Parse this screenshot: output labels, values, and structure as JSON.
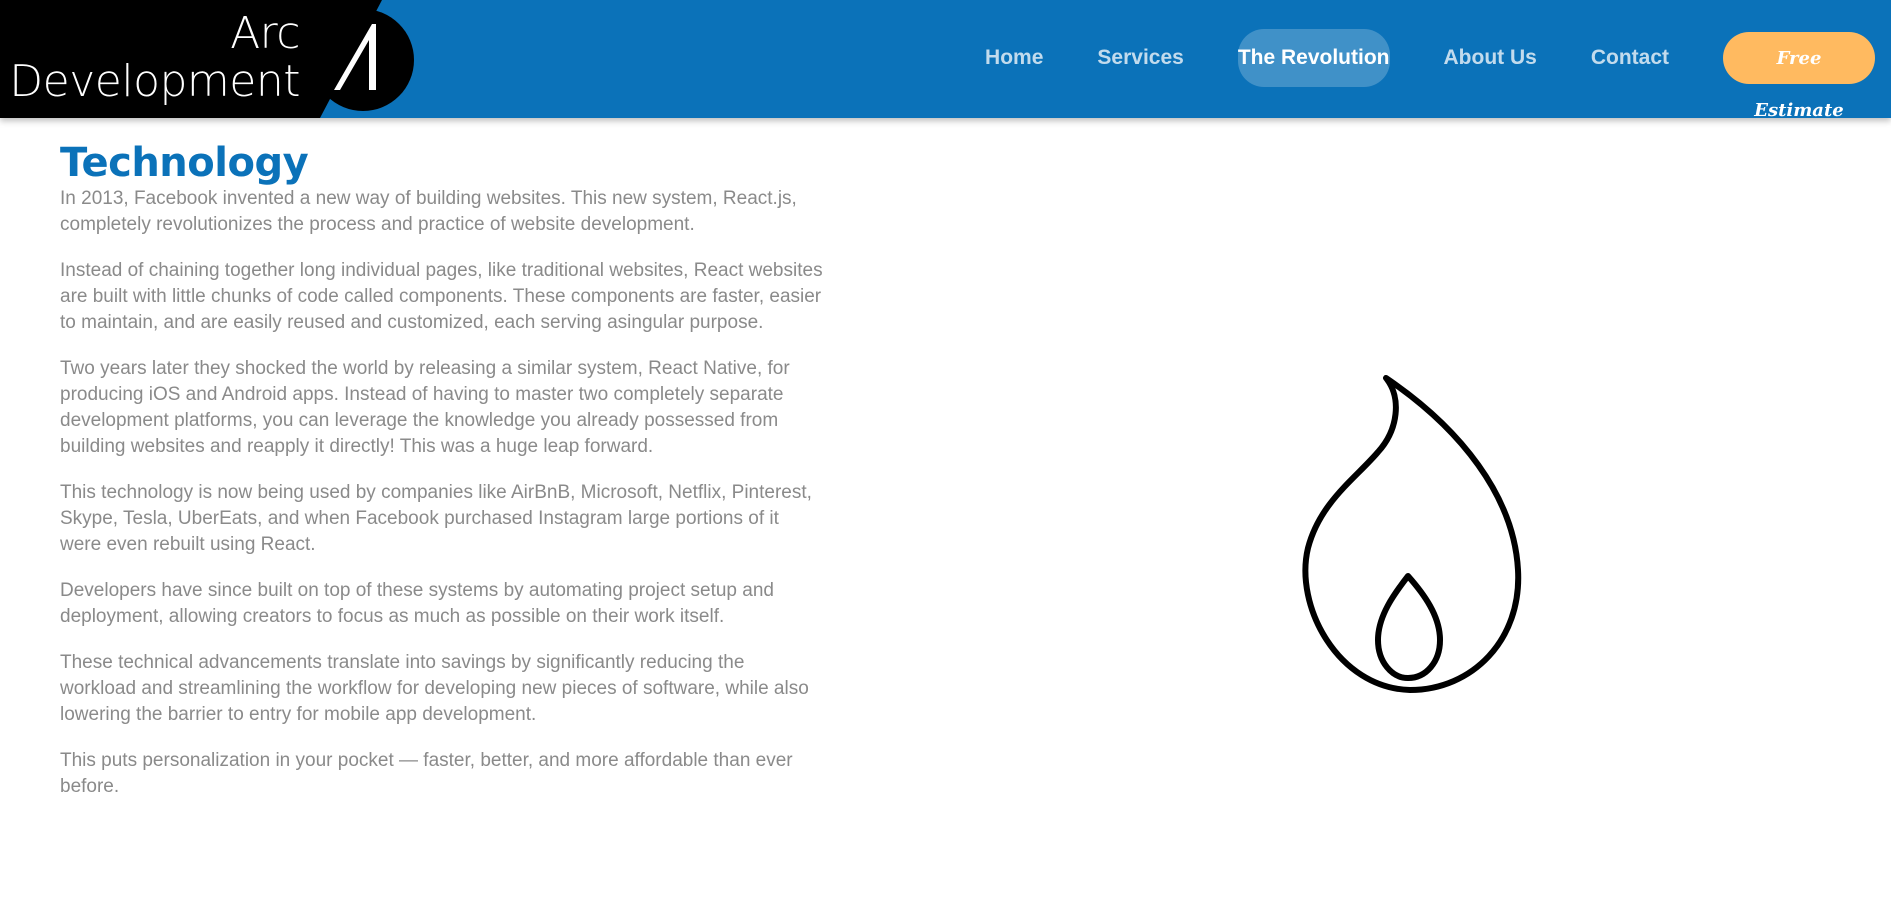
{
  "header": {
    "logo": {
      "line1": "Arc",
      "line2": "Development",
      "icon": "arc-logo-icon"
    },
    "nav": [
      {
        "label": "Home",
        "active": false
      },
      {
        "label": "Services",
        "active": false
      },
      {
        "label": "The Revolution",
        "active": true
      },
      {
        "label": "About Us",
        "active": false
      },
      {
        "label": "Contact",
        "active": false
      }
    ],
    "estimate_label": "Free Estimate"
  },
  "main": {
    "title": "Technology",
    "paragraphs": [
      "In 2013, Facebook invented a new way of building websites. This new system, React.js, completely revolutionizes the process and practice of website development.",
      "Instead of chaining together long individual pages, like traditional websites, React websites are built with little chunks of code called components. These components are faster, easier to maintain, and are easily reused and customized, each serving asingular purpose.",
      "Two years later they shocked the world by releasing a similar system, React Native, for producing iOS and Android apps. Instead of having to master two completely separate development platforms, you can leverage the knowledge you already possessed from building websites and reapply it directly! This was a huge leap forward.",
      "This technology is now being used by companies like AirBnB, Microsoft, Netflix, Pinterest, Skype, Tesla, UberEats, and when Facebook purchased Instagram large portions of it were even rebuilt using React.",
      "Developers have since built on top of these systems by automating project setup and deployment, allowing creators to focus as much as possible on their work itself.",
      "These technical advancements translate into savings by significantly reducing the workload and streamlining the workflow for developing new pieces of software, while also lowering the barrier to entry for mobile app development.",
      "This puts personalization in your pocket — faster, better, and more affordable than ever before."
    ],
    "illustration": "flame-icon"
  },
  "colors": {
    "header_blue": "#0B72B9",
    "accent_orange": "#FFBA60",
    "body_text": "#8a8a8a"
  }
}
